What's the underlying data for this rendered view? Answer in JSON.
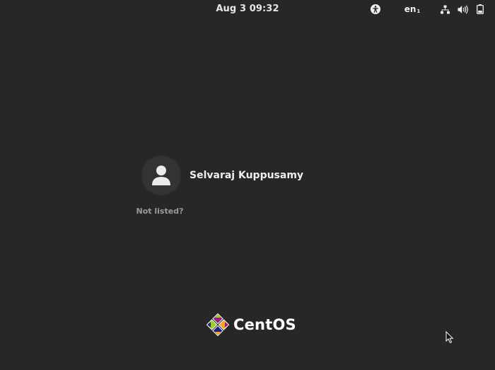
{
  "top_bar": {
    "clock": "Aug 3  09:32",
    "language_label": "en",
    "language_index": "1",
    "icons": {
      "accessibility": "accessibility-icon",
      "network": "network-wired-icon",
      "volume": "volume-icon",
      "battery": "battery-icon"
    }
  },
  "login": {
    "users": [
      {
        "name": "Selvaraj Kuppusamy",
        "avatar": "user-avatar-icon"
      }
    ],
    "not_listed_label": "Not listed?"
  },
  "branding": {
    "logo_text": "CentOS",
    "colors": {
      "purple": "#932279",
      "yellow": "#efa724",
      "green": "#9ccd2a",
      "blue": "#262577"
    }
  },
  "theme": {
    "background": "#272727",
    "text": "#efefef",
    "muted_text": "#9b9b9b"
  }
}
